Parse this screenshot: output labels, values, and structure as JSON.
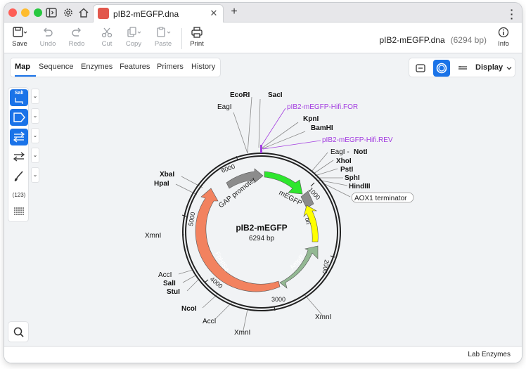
{
  "tab": {
    "title": "pIB2-mEGFP.dna"
  },
  "toolbar": {
    "save": "Save",
    "undo": "Undo",
    "redo": "Redo",
    "cut": "Cut",
    "copy": "Copy",
    "paste": "Paste",
    "print": "Print",
    "info": "Info"
  },
  "document": {
    "name": "pIB2-mEGFP.dna",
    "length": "(6294 bp)"
  },
  "view_tabs": [
    "Map",
    "Sequence",
    "Enzymes",
    "Features",
    "Primers",
    "History"
  ],
  "display": {
    "label": "Display"
  },
  "left_tools": {
    "enzyme_badge": "SalI",
    "count": "(123)"
  },
  "map": {
    "name": "pIB2-mEGFP",
    "length": "6294 bp",
    "ticks": [
      "1000",
      "2000",
      "3000",
      "4000",
      "5000",
      "6000"
    ],
    "features": [
      {
        "label": "mEGFP",
        "color": "#2ee62e"
      },
      {
        "label": "ori",
        "color": "#ffff00"
      },
      {
        "label": "AmpR",
        "color": "#93b893"
      },
      {
        "label": "FpHIS4",
        "color": "#f2825f"
      },
      {
        "label": "GAP promoter",
        "color": "#8c8c8c"
      }
    ],
    "terminator": "AOX1 terminator",
    "primers": [
      "pIB2-mEGFP-Hifi.FOR",
      "pIB2-mEGFP-Hifi.REV"
    ],
    "enzymes": {
      "ecori": "EcoRI",
      "saci": "SacI",
      "eagi_top": "EagI",
      "kpni": "KpnI",
      "bamhi": "BamHI",
      "eagi_right": "EagI - ",
      "noti": "NotI",
      "xhoi": "XhoI",
      "psti": "PstI",
      "sphi": "SphI",
      "hindiii": "HindIII",
      "xbai": "XbaI",
      "hpai": "HpaI",
      "xmni_left": "XmnI",
      "acci_left": "AccI",
      "sali": "SalI",
      "stui": "StuI",
      "ncoi": "NcoI",
      "acci_bottom": "AccI",
      "xmni_bottom": "XmnI",
      "xmni_right": "XmnI"
    }
  },
  "footer": {
    "label": "Lab Enzymes"
  }
}
